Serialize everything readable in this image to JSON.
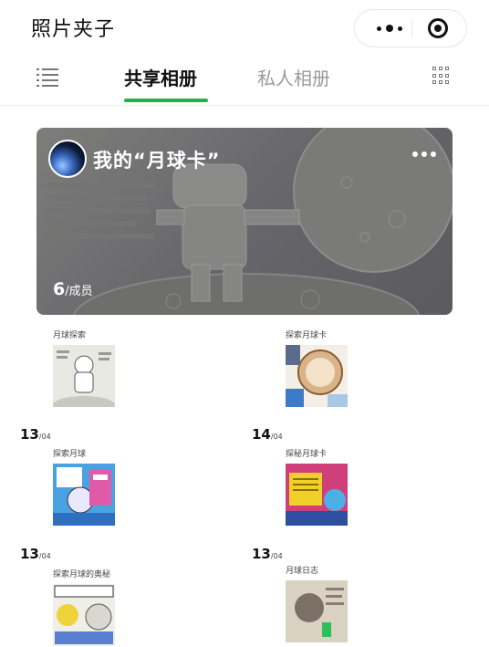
{
  "app": {
    "title": "照片夹子"
  },
  "tabs": {
    "shared": "共享相册",
    "private": "私人相册"
  },
  "banner": {
    "title": "我的“月球卡”",
    "member_count": "6",
    "member_unit": "/成员"
  },
  "albums": [
    {
      "name": "月球探索"
    },
    {
      "name": "探索月球卡"
    },
    {
      "name": "探索月球"
    },
    {
      "name": "探秘月球卡"
    },
    {
      "name": "探索月球的奥秘"
    },
    {
      "name": "月球日志"
    }
  ],
  "dates": [
    {
      "day": "13",
      "month": "/04"
    },
    {
      "day": "14",
      "month": "/04"
    },
    {
      "day": "13",
      "month": "/04"
    },
    {
      "day": "13",
      "month": "/04"
    }
  ],
  "colors": {
    "accent": "#22b14c"
  },
  "icons": {
    "menu": "more-dots-icon",
    "close": "target-icon",
    "list": "list-icon",
    "grid": "grid-icon"
  }
}
